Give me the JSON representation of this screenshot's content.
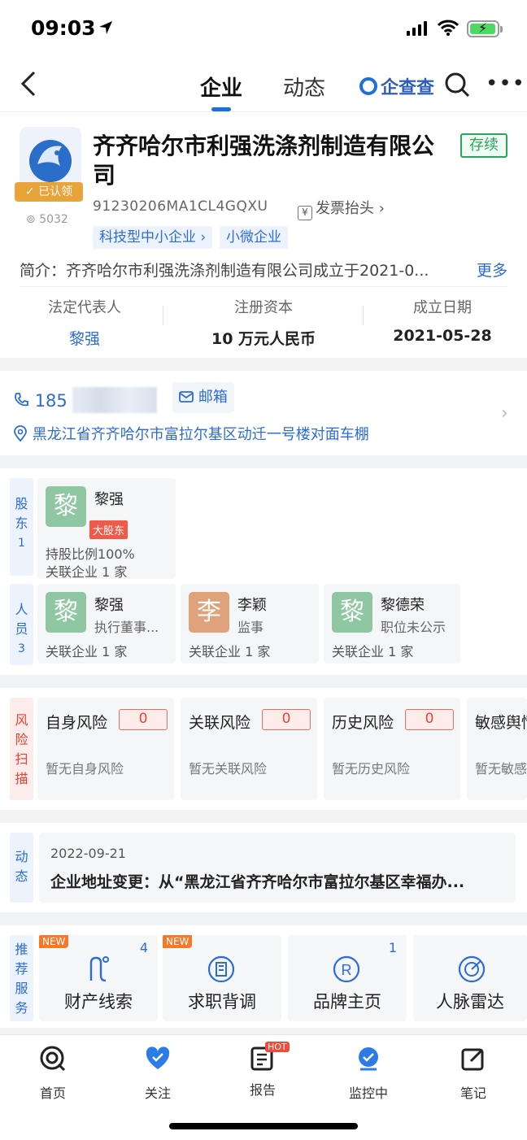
{
  "status_bar": {
    "time": "09:03"
  },
  "nav": {
    "tabs": [
      "企业",
      "动态"
    ],
    "brand": "企查查"
  },
  "company": {
    "name": "齐齐哈尔市利强洗涤剂制造有限公司",
    "verified": "已认领",
    "views": "5032",
    "status": "存续",
    "credit_code": "91230206MA1CL4GQXU",
    "invoice": "发票抬头",
    "tags": [
      "科技型中小企业",
      "小微企业"
    ],
    "intro": "简介：齐齐哈尔市利强洗涤剂制造有限公司成立于2021-0...",
    "intro_more": "更多",
    "stats": [
      {
        "label": "法定代表人",
        "value": "黎强"
      },
      {
        "label": "注册资本",
        "value": "10 万元人民币"
      },
      {
        "label": "成立日期",
        "value": "2021-05-28"
      }
    ]
  },
  "contact": {
    "phone_prefix": "185",
    "email": "邮箱",
    "address": "黑龙江省齐齐哈尔市富拉尔基区动迁一号楼对面车棚"
  },
  "shareholders": {
    "label": [
      "股",
      "东",
      "1"
    ],
    "items": [
      {
        "avatar": "黎",
        "name": "黎强",
        "badge": "大股东",
        "ratio": "持股比例100%",
        "related": "关联企业 1 家"
      }
    ]
  },
  "personnel": {
    "label": [
      "人",
      "员",
      "3"
    ],
    "items": [
      {
        "avatar": "黎",
        "name": "黎强",
        "role": "执行董事...",
        "related": "关联企业 1 家"
      },
      {
        "avatar": "李",
        "name": "李颖",
        "role": "监事",
        "related": "关联企业 1 家"
      },
      {
        "avatar": "黎",
        "name": "黎德荣",
        "role": "职位未公示",
        "related": "关联企业 1 家"
      }
    ]
  },
  "risk": {
    "label": [
      "风",
      "险",
      "扫",
      "描"
    ],
    "items": [
      {
        "title": "自身风险",
        "count": "0",
        "note": "暂无自身风险"
      },
      {
        "title": "关联风险",
        "count": "0",
        "note": "暂无关联风险"
      },
      {
        "title": "历史风险",
        "count": "0",
        "note": "暂无历史风险"
      },
      {
        "title": "敏感舆情",
        "count": "",
        "note": "暂无敏感舆情"
      }
    ]
  },
  "dynamics": {
    "label": [
      "动",
      "态"
    ],
    "date": "2022-09-21",
    "text": "企业地址变更：从“黑龙江省齐齐哈尔市富拉尔基区幸福办..."
  },
  "services": {
    "label": [
      "推",
      "荐",
      "服",
      "务"
    ],
    "items": [
      {
        "name": "财产线索",
        "new": "NEW",
        "count": "4"
      },
      {
        "name": "求职背调",
        "new": "NEW",
        "count": ""
      },
      {
        "name": "品牌主页",
        "new": "",
        "count": "1"
      },
      {
        "name": "人脉雷达",
        "new": "",
        "count": ""
      }
    ]
  },
  "tabbar": {
    "items": [
      "首页",
      "关注",
      "报告",
      "监控中",
      "笔记"
    ],
    "hot": "HOT"
  }
}
